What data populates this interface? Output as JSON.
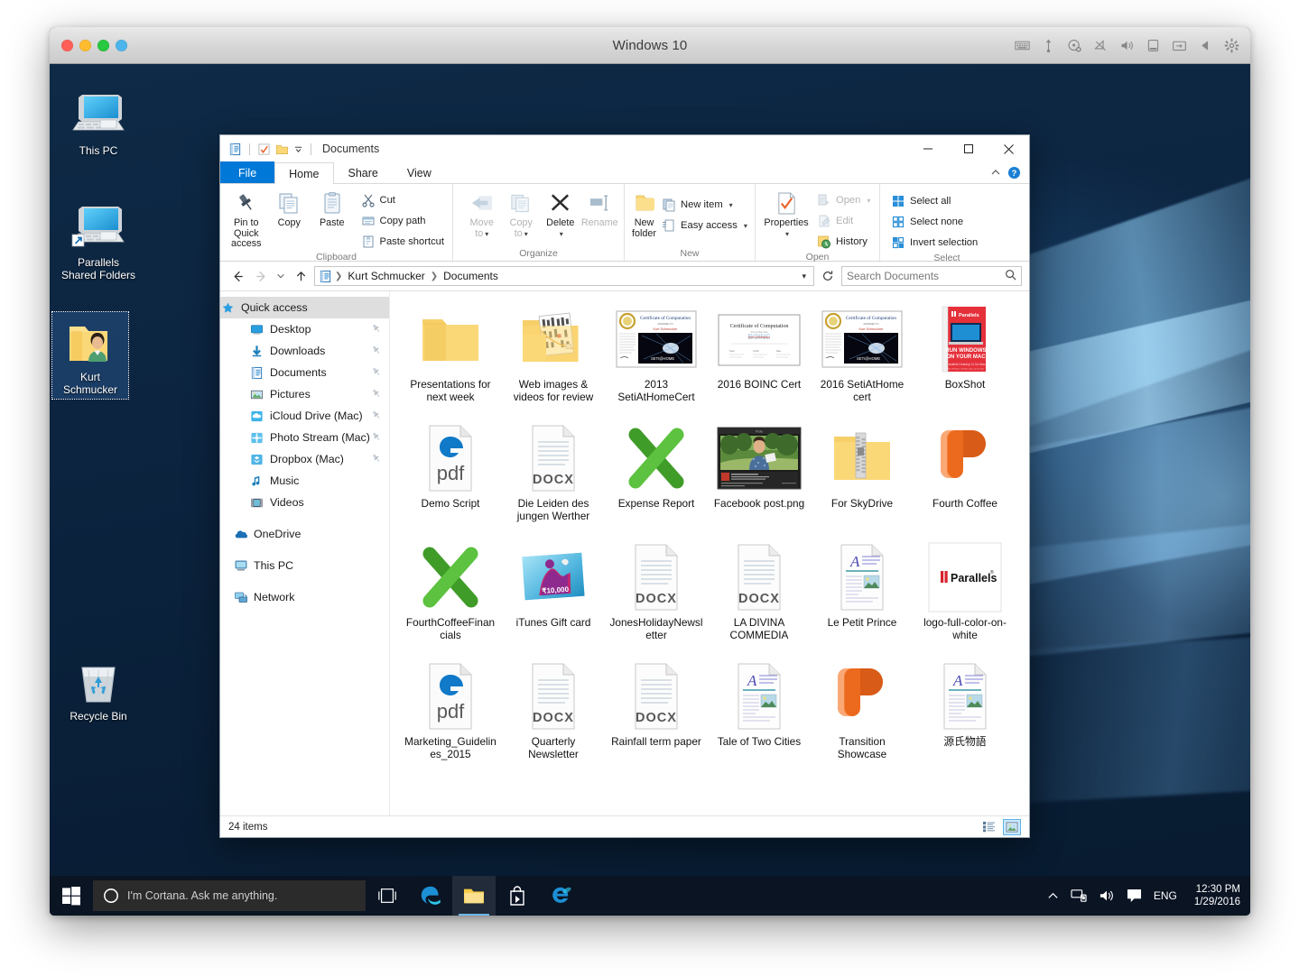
{
  "mac": {
    "title": "Windows 10",
    "traffic_lights": [
      "close",
      "minimize",
      "zoom",
      "coherence"
    ],
    "toolbar_icons": [
      "keyboard-icon",
      "usb-icon",
      "cd-eject-icon",
      "network-disconnected-icon",
      "volume-icon",
      "battery-icon",
      "shared-folder-icon",
      "previous-icon",
      "gear-icon"
    ]
  },
  "desktop": {
    "icons": [
      {
        "label": "This PC",
        "icon": "this-pc-icon",
        "selected": false
      },
      {
        "label": "Parallels\nShared Folders",
        "label_l1": "Parallels",
        "label_l2": "Shared Folders",
        "icon": "shared-folders-icon",
        "selected": false
      },
      {
        "label": "Kurt\nSchmucker",
        "label_l1": "Kurt",
        "label_l2": "Schmucker",
        "icon": "user-folder-icon",
        "selected": true
      },
      {
        "label": "Recycle Bin",
        "icon": "recycle-bin-icon",
        "selected": false
      }
    ]
  },
  "explorer": {
    "title": "Documents",
    "quick_access_toolbar": [
      "documents-properties-icon",
      "qat-sep",
      "checkmark-icon",
      "folder-icon",
      "qat-dropdown-icon",
      "qat-sep2"
    ],
    "window_buttons": {
      "minimize": "minimize-icon",
      "maximize": "maximize-icon",
      "close": "close-icon"
    },
    "tabs": [
      {
        "label": "File",
        "kind": "file"
      },
      {
        "label": "Home",
        "kind": "active"
      },
      {
        "label": "Share",
        "kind": "normal"
      },
      {
        "label": "View",
        "kind": "normal"
      }
    ],
    "tabs_right": [
      "collapse-ribbon-icon",
      "help-icon"
    ],
    "ribbon": {
      "groups": [
        {
          "title": "Clipboard",
          "big_buttons": [
            {
              "label": "Pin to Quick access",
              "l1": "Pin to Quick",
              "l2": "access",
              "icon": "pin-icon",
              "disabled": false
            },
            {
              "label": "Copy",
              "icon": "copy-icon",
              "disabled": false
            },
            {
              "label": "Paste",
              "icon": "paste-icon",
              "disabled": false
            }
          ],
          "small_buttons": [
            {
              "label": "Cut",
              "icon": "cut-icon",
              "disabled": false
            },
            {
              "label": "Copy path",
              "icon": "copy-path-icon",
              "disabled": false
            },
            {
              "label": "Paste shortcut",
              "icon": "paste-shortcut-icon",
              "disabled": false
            }
          ]
        },
        {
          "title": "Organize",
          "big_buttons": [
            {
              "label": "Move to",
              "l1": "Move",
              "l2": "to",
              "icon": "move-to-icon",
              "dropdown": true,
              "disabled": true
            },
            {
              "label": "Copy to",
              "l1": "Copy",
              "l2": "to",
              "icon": "copy-to-icon",
              "dropdown": true,
              "disabled": true
            },
            {
              "label": "Delete",
              "icon": "delete-icon",
              "dropdown": true,
              "disabled": false
            },
            {
              "label": "Rename",
              "icon": "rename-icon",
              "disabled": true
            }
          ],
          "small_buttons": []
        },
        {
          "title": "New",
          "big_buttons": [
            {
              "label": "New folder",
              "l1": "New",
              "l2": "folder",
              "icon": "new-folder-icon",
              "disabled": false
            }
          ],
          "small_buttons": [
            {
              "label": "New item",
              "icon": "new-item-icon",
              "dropdown": true,
              "disabled": false
            },
            {
              "label": "Easy access",
              "icon": "easy-access-icon",
              "dropdown": true,
              "disabled": false
            }
          ]
        },
        {
          "title": "Open",
          "big_buttons": [
            {
              "label": "Properties",
              "icon": "properties-icon",
              "dropdown": true,
              "disabled": false
            }
          ],
          "small_buttons": [
            {
              "label": "Open",
              "icon": "open-icon",
              "dropdown": true,
              "disabled": true
            },
            {
              "label": "Edit",
              "icon": "edit-icon",
              "disabled": true
            },
            {
              "label": "History",
              "icon": "history-icon",
              "disabled": false
            }
          ]
        },
        {
          "title": "Select",
          "big_buttons": [],
          "small_buttons": [
            {
              "label": "Select all",
              "icon": "select-all-icon",
              "disabled": false
            },
            {
              "label": "Select none",
              "icon": "select-none-icon",
              "disabled": false
            },
            {
              "label": "Invert selection",
              "icon": "invert-selection-icon",
              "disabled": false
            }
          ]
        }
      ]
    },
    "address_bar": {
      "back": "back-arrow-icon",
      "forward": "forward-arrow-icon",
      "recent": "recent-locations-icon",
      "up": "up-arrow-icon",
      "crumb_icon": "documents-icon",
      "breadcrumbs": [
        "Kurt Schmucker",
        "Documents"
      ],
      "dropdown": "crumb-dropdown-icon",
      "refresh": "refresh-icon"
    },
    "search": {
      "placeholder": "Search Documents",
      "value": "",
      "icon": "search-icon"
    },
    "nav_pane": {
      "groups": [
        {
          "header": {
            "label": "Quick access",
            "icon": "quick-access-star-icon",
            "selected": true
          },
          "items": [
            {
              "label": "Desktop",
              "icon": "desktop-icon",
              "pinned": true
            },
            {
              "label": "Downloads",
              "icon": "downloads-icon",
              "pinned": true
            },
            {
              "label": "Documents",
              "icon": "documents-icon",
              "pinned": true
            },
            {
              "label": "Pictures",
              "icon": "pictures-icon",
              "pinned": true
            },
            {
              "label": "iCloud Drive (Mac)",
              "icon": "icloud-icon",
              "pinned": true
            },
            {
              "label": "Photo Stream (Mac)",
              "icon": "photostream-icon",
              "pinned": true
            },
            {
              "label": "Dropbox (Mac)",
              "icon": "dropbox-icon",
              "pinned": true
            },
            {
              "label": "Music",
              "icon": "music-icon",
              "pinned": false
            },
            {
              "label": "Videos",
              "icon": "videos-icon",
              "pinned": false
            }
          ]
        },
        {
          "header": {
            "label": "OneDrive",
            "icon": "onedrive-icon",
            "selected": false
          },
          "items": []
        },
        {
          "header": {
            "label": "This PC",
            "icon": "this-pc-icon",
            "selected": false
          },
          "items": []
        },
        {
          "header": {
            "label": "Network",
            "icon": "network-icon",
            "selected": false
          },
          "items": []
        }
      ]
    },
    "files": [
      {
        "name": "Presentations for next week",
        "type": "folder"
      },
      {
        "name": "Web images & videos for review",
        "type": "folder-pictures"
      },
      {
        "name": "2013 SetiAtHomeCert",
        "type": "cert-seti"
      },
      {
        "name": "2016 BOINC Cert",
        "type": "cert-boinc"
      },
      {
        "name": "2016 SetiAtHome cert",
        "type": "cert-seti"
      },
      {
        "name": "BoxShot",
        "type": "image-boxshot"
      },
      {
        "name": "Demo Script",
        "type": "pdf"
      },
      {
        "name": "Die Leiden des jungen Werther",
        "type": "docx"
      },
      {
        "name": "Expense Report",
        "type": "xlsx"
      },
      {
        "name": "Facebook post.png",
        "type": "image-facebook"
      },
      {
        "name": "For SkyDrive",
        "type": "zip-folder"
      },
      {
        "name": "Fourth Coffee",
        "type": "pptx"
      },
      {
        "name": "FourthCoffeeFinancials",
        "type": "xlsx"
      },
      {
        "name": "iTunes Gift card",
        "type": "image-itunes"
      },
      {
        "name": "JonesHolidayNewsletter",
        "type": "docx"
      },
      {
        "name": "LA DIVINA COMMEDIA",
        "type": "docx"
      },
      {
        "name": "Le Petit Prince",
        "type": "doc-preview"
      },
      {
        "name": "logo-full-color-on-white",
        "type": "image-parallels"
      },
      {
        "name": "Marketing_Guidelines_2015",
        "type": "pdf"
      },
      {
        "name": "Quarterly Newsletter",
        "type": "docx"
      },
      {
        "name": "Rainfall term paper",
        "type": "docx"
      },
      {
        "name": "Tale of Two Cities",
        "type": "doc-preview"
      },
      {
        "name": "Transition Showcase",
        "type": "pptx"
      },
      {
        "name": "源氏物語",
        "type": "doc-preview"
      }
    ],
    "status": {
      "item_count": "24 items",
      "views": [
        "details-view-icon",
        "large-icons-view-icon"
      ],
      "active_view": "large-icons-view-icon"
    }
  },
  "taskbar": {
    "start": "windows-start-icon",
    "cortana": {
      "placeholder": "I'm Cortana. Ask me anything.",
      "icon": "cortana-circle-icon"
    },
    "apps": [
      {
        "name": "task-view-icon",
        "active": false
      },
      {
        "name": "microsoft-edge-icon",
        "active": false
      },
      {
        "name": "file-explorer-icon",
        "active": true
      },
      {
        "name": "store-icon",
        "active": false
      },
      {
        "name": "internet-explorer-icon",
        "active": false
      }
    ],
    "tray": {
      "icons": [
        "show-hidden-icons-chevron",
        "network-icon",
        "volume-icon",
        "action-center-icon"
      ],
      "language": "ENG",
      "time": "12:30 PM",
      "date": "1/29/2016"
    }
  },
  "colors": {
    "accent_blue": "#0078d7",
    "ribbon_bg": "#ffffff",
    "taskbar_bg": "#0a1423",
    "selection": "#dedede",
    "folder_yellow": "#fbd877",
    "excel_green": "#4caf2e",
    "ppt_orange": "#ed6c1f",
    "parallels_red": "#d7232e"
  }
}
